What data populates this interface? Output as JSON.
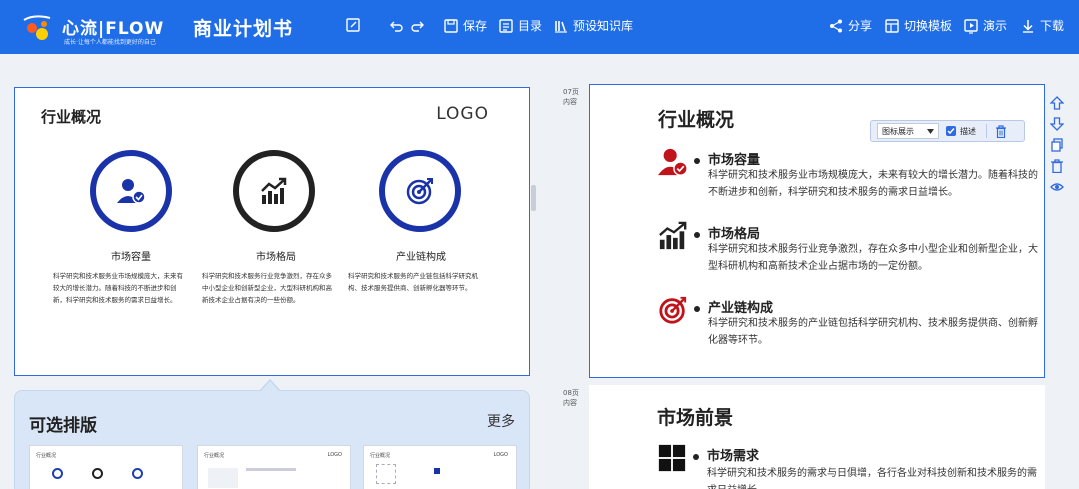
{
  "app": {
    "brand_name": "心流|FLOW",
    "brand_sub": "成长·让每个人都能找到更好的自己",
    "doc_title": "商业计划书"
  },
  "toolbar": {
    "save_label": "保存",
    "toc_label": "目录",
    "kb_label": "预设知识库",
    "share_label": "分享",
    "template_label": "切换模板",
    "present_label": "演示",
    "download_label": "下载"
  },
  "editor_slide": {
    "heading": "行业概况",
    "logo_text": "LOGO",
    "columns": [
      {
        "title": "市场容量",
        "text": "科学研究和技术服务业市场规模庞大，未来有较大的增长潜力。随着科技的不断进步和创新，科学研究和技术服务的需求日益增长。",
        "color": "#1b33a8",
        "icon": "user-check-icon"
      },
      {
        "title": "市场格局",
        "text": "科学研究和技术服务行业竞争激烈，存在众多中小型企业和创新型企业，大型科研机构和高新技术企业占据有决的一些份额。",
        "color": "#222222",
        "icon": "chart-up-icon"
      },
      {
        "title": "产业链构成",
        "text": "科学研究和技术服务的产业链包括科学研究机构、技术服务提供商、创新孵化器等环节。",
        "color": "#1b33a8",
        "icon": "target-icon"
      }
    ]
  },
  "picker": {
    "title": "可选排版",
    "more_label": "更多",
    "thumbs": [
      {
        "label": "行业概况",
        "logo": "LOGO"
      },
      {
        "label": "行业概况",
        "logo": "LOGO"
      },
      {
        "label": "行业概况",
        "logo": "LOGO"
      }
    ]
  },
  "pages": [
    {
      "num": "07页",
      "tag": "内容"
    },
    {
      "num": "08页",
      "tag": "内容"
    }
  ],
  "preview_slide": {
    "heading": "行业概况",
    "items": [
      {
        "title": "市场容量",
        "text": "科学研究和技术服务业市场规模庞大，未来有较大的增长潜力。随着科技的不断进步和创新，科学研究和技术服务的需求日益增长。",
        "icon": "user-check-icon",
        "color": "#c0141c"
      },
      {
        "title": "市场格局",
        "text": "科学研究和技术服务行业竞争激烈，存在众多中小型企业和创新型企业，大型科研机构和高新技术企业占据市场的一定份额。",
        "icon": "chart-up-icon",
        "color": "#222222"
      },
      {
        "title": "产业链构成",
        "text": "科学研究和技术服务的产业链包括科学研究机构、技术服务提供商、创新孵化器等环节。",
        "icon": "target-icon",
        "color": "#c0141c"
      }
    ],
    "float_toolbar": {
      "select_value": "图标展示",
      "check_label": "描述",
      "checked": true
    }
  },
  "preview_slide2": {
    "heading": "市场前景",
    "items": [
      {
        "title": "市场需求",
        "text": "科学研究和技术服务的需求与日俱增，各行各业对科技创新和技术服务的需求日益增长。",
        "icon": "grid-icon"
      }
    ]
  },
  "colors": {
    "brand_blue": "#1f6ee8",
    "accent_red": "#c0141c",
    "navy": "#1b33a8"
  }
}
